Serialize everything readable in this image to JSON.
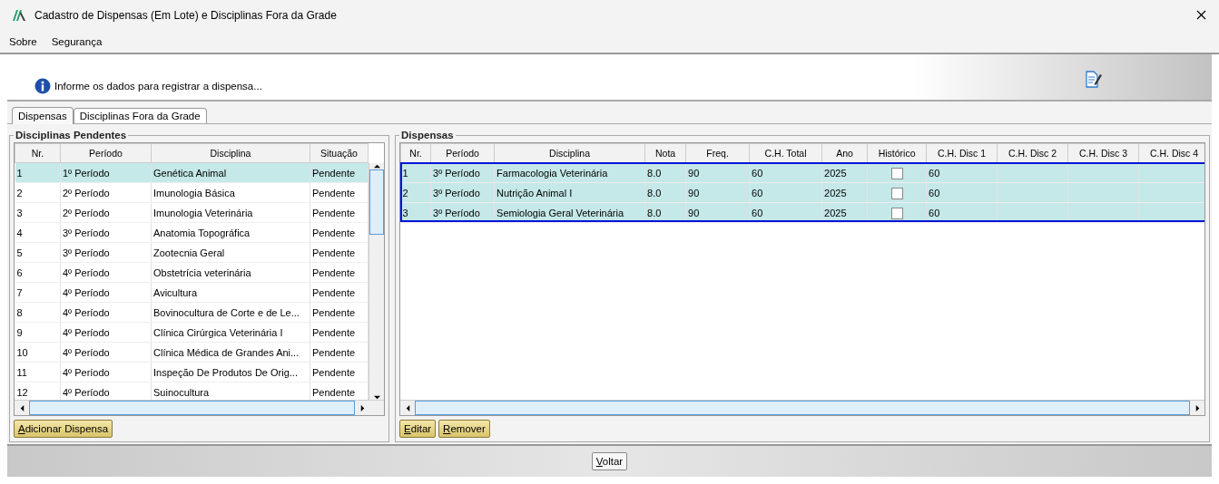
{
  "window": {
    "title": "Cadastro de Dispensas (Em Lote) e Disciplinas Fora da Grade"
  },
  "menu": [
    "Sobre",
    "Segurança"
  ],
  "info_message": "Informe os dados para registrar a dispensa...",
  "tabs": [
    {
      "label": "Dispensas",
      "selected": true
    },
    {
      "label": "Disciplinas Fora da Grade",
      "selected": false
    }
  ],
  "pending": {
    "title": "Disciplinas Pendentes",
    "columns": [
      "Nr.",
      "Período",
      "Disciplina",
      "Situação"
    ],
    "rows": [
      {
        "cells": [
          "1",
          "1º Período",
          "Genética Animal",
          "Pendente"
        ],
        "selected": true
      },
      {
        "cells": [
          "2",
          "2º Período",
          " Imunologia Básica",
          "Pendente"
        ],
        "selected": false
      },
      {
        "cells": [
          "3",
          "2º Período",
          "Imunologia Veterinária",
          "Pendente"
        ],
        "selected": false
      },
      {
        "cells": [
          "4",
          "3º Período",
          "Anatomia Topográfica",
          "Pendente"
        ],
        "selected": false
      },
      {
        "cells": [
          "5",
          "3º Período",
          "Zootecnia Geral",
          "Pendente"
        ],
        "selected": false
      },
      {
        "cells": [
          "6",
          "4º Período",
          " Obstetrícia veterinária",
          "Pendente"
        ],
        "selected": false
      },
      {
        "cells": [
          "7",
          "4º Período",
          "Avicultura",
          "Pendente"
        ],
        "selected": false
      },
      {
        "cells": [
          "8",
          "4º Período",
          "Bovinocultura de Corte e de Le...",
          "Pendente"
        ],
        "selected": false
      },
      {
        "cells": [
          "9",
          "4º Período",
          "Clínica Cirúrgica Veterinária I",
          "Pendente"
        ],
        "selected": false
      },
      {
        "cells": [
          "10",
          "4º Período",
          "Clínica Médica de Grandes Ani...",
          "Pendente"
        ],
        "selected": false
      },
      {
        "cells": [
          "11",
          "4º Período",
          "Inspeção De Produtos De Orig...",
          "Pendente"
        ],
        "selected": false
      },
      {
        "cells": [
          "12",
          "4º Período",
          "Suinocultura",
          "Pendente"
        ],
        "selected": false
      }
    ],
    "button": "Adicionar Dispensa"
  },
  "dispensas": {
    "title": "Dispensas",
    "columns": [
      "Nr.",
      "Período",
      "Disciplina",
      "Nota",
      "Freq.",
      "C.H. Total",
      "Ano",
      "Histórico",
      "C.H. Disc 1",
      "C.H. Disc 2",
      "C.H. Disc 3",
      "C.H. Disc 4"
    ],
    "rows": [
      {
        "nr": "1",
        "periodo": "3º Período",
        "disciplina": "Farmacologia Veterinária",
        "nota": "8.0",
        "freq": "90",
        "ch_total": "60",
        "ano": "2025",
        "historico": false,
        "ch_disc_1": "60",
        "selected": true
      },
      {
        "nr": "2",
        "periodo": "3º Período",
        "disciplina": "Nutrição Animal I",
        "nota": "8.0",
        "freq": "90",
        "ch_total": "60",
        "ano": "2025",
        "historico": false,
        "ch_disc_1": "60",
        "selected": true
      },
      {
        "nr": "3",
        "periodo": "3º Período",
        "disciplina": "Semiologia Geral Veterinária",
        "nota": "8.0",
        "freq": "90",
        "ch_total": "60",
        "ano": "2025",
        "historico": false,
        "ch_disc_1": "60",
        "selected": true
      }
    ],
    "buttons": [
      "Editar",
      "Remover"
    ]
  },
  "footer_button": "Voltar"
}
